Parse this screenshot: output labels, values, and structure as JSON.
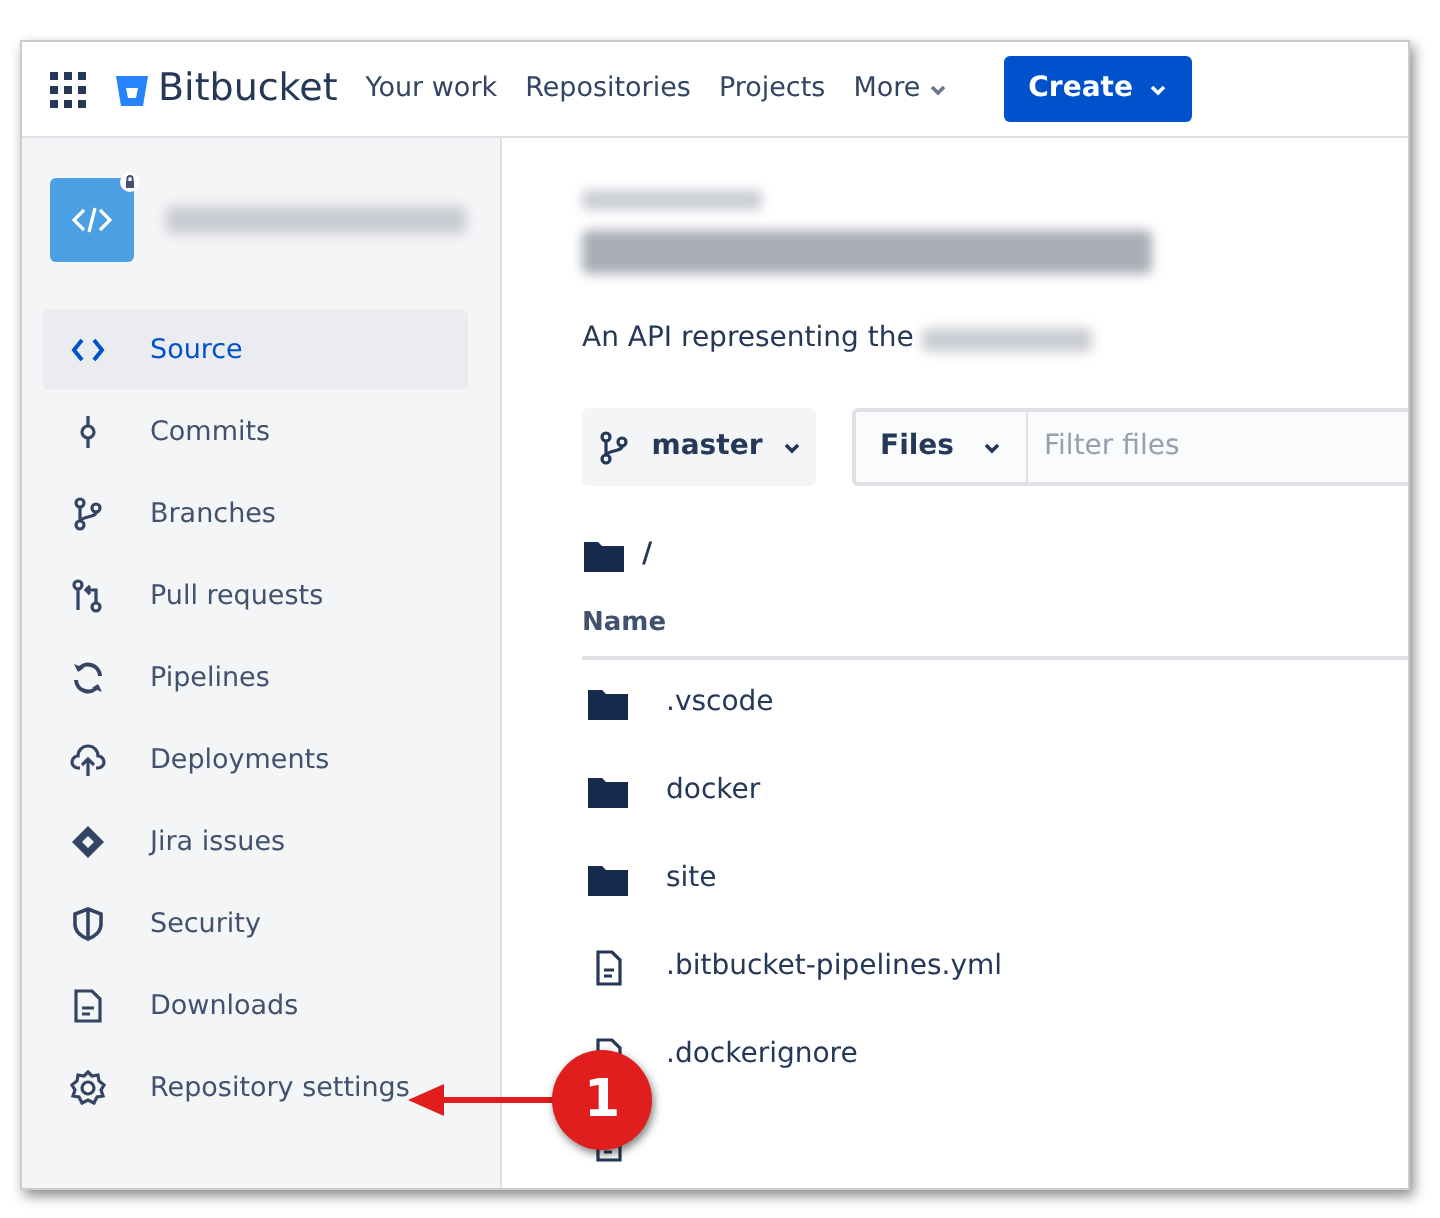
{
  "topbar": {
    "product": "Bitbucket",
    "nav": [
      {
        "label": "Your work",
        "dropdown": false
      },
      {
        "label": "Repositories",
        "dropdown": false
      },
      {
        "label": "Projects",
        "dropdown": false
      },
      {
        "label": "More",
        "dropdown": true
      }
    ],
    "create_button": "Create"
  },
  "sidebar": {
    "items": [
      {
        "label": "Source",
        "selected": true
      },
      {
        "label": "Commits",
        "selected": false
      },
      {
        "label": "Branches",
        "selected": false
      },
      {
        "label": "Pull requests",
        "selected": false
      },
      {
        "label": "Pipelines",
        "selected": false
      },
      {
        "label": "Deployments",
        "selected": false
      },
      {
        "label": "Jira issues",
        "selected": false
      },
      {
        "label": "Security",
        "selected": false
      },
      {
        "label": "Downloads",
        "selected": false
      },
      {
        "label": "Repository settings",
        "selected": false
      }
    ]
  },
  "main": {
    "description": "An API representing the",
    "branch": "master",
    "file_filter": {
      "mode": "Files",
      "placeholder": "Filter files"
    },
    "path": "/",
    "columns": [
      "Name"
    ],
    "rows": [
      {
        "kind": "folder",
        "name": ".vscode"
      },
      {
        "kind": "folder",
        "name": "docker"
      },
      {
        "kind": "folder",
        "name": "site"
      },
      {
        "kind": "file",
        "name": ".bitbucket-pipelines.yml"
      },
      {
        "kind": "file",
        "name": ".dockerignore"
      },
      {
        "kind": "file"
      }
    ]
  },
  "callout": {
    "number": "1"
  }
}
